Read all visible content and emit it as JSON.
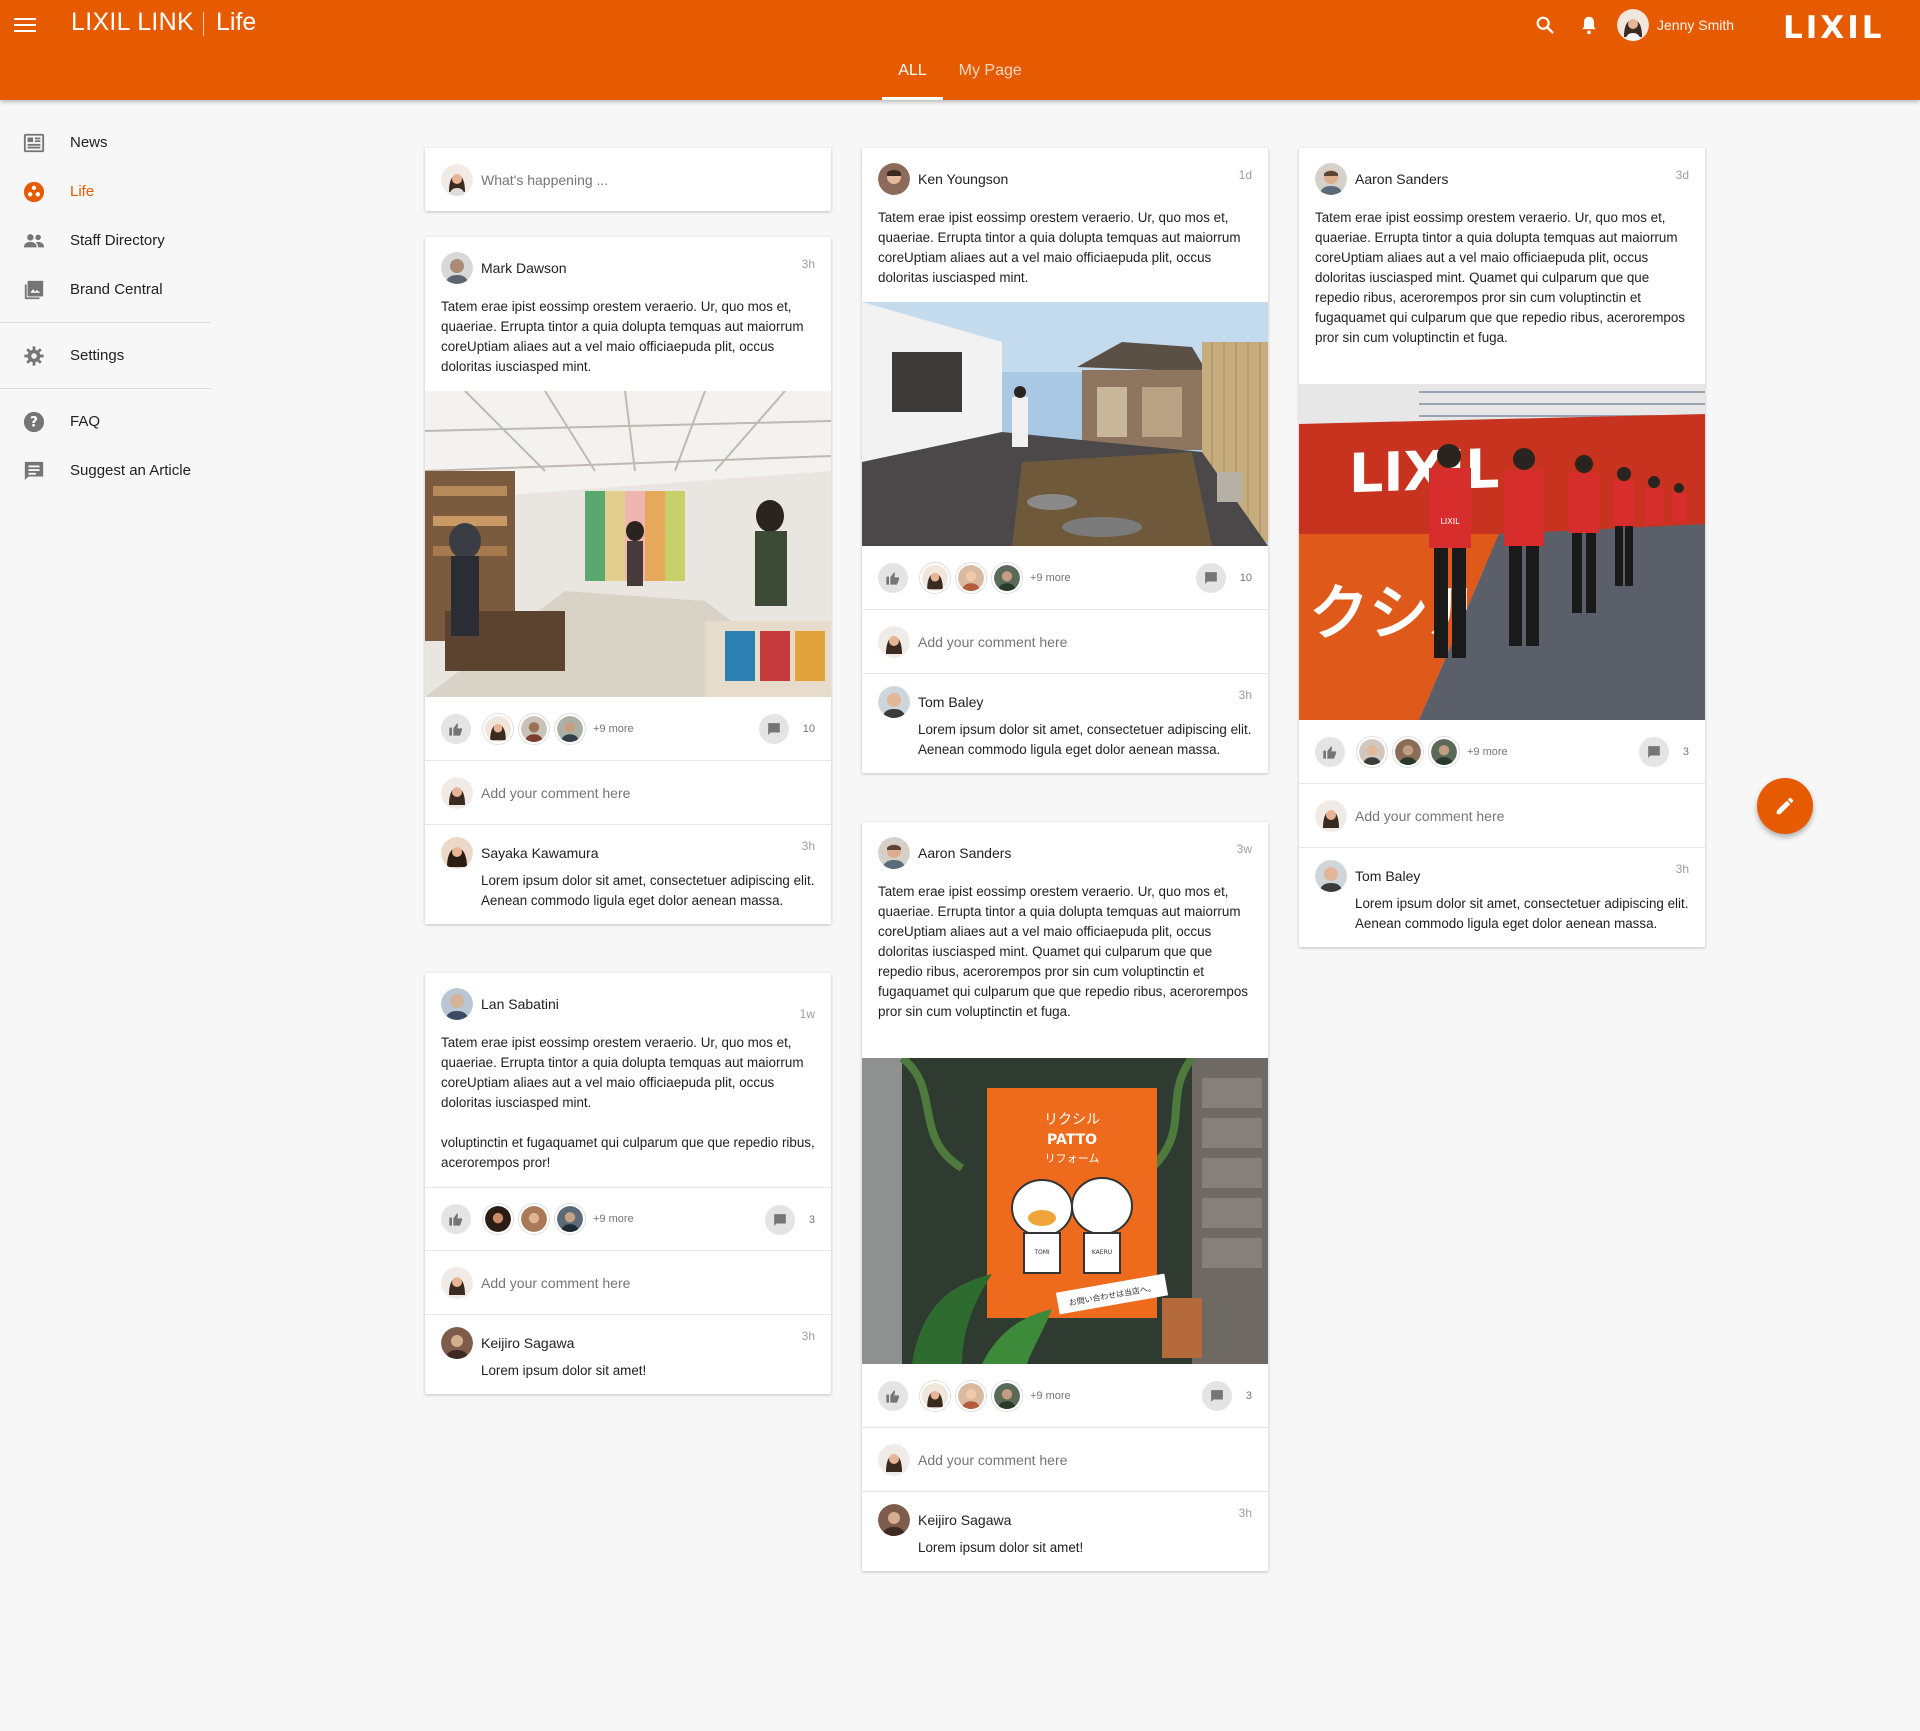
{
  "header": {
    "app_title": "LIXIL LINK",
    "section_title": "Life",
    "user_name": "Jenny Smith",
    "brand": "LIXIL",
    "tabs": [
      {
        "label": "ALL"
      },
      {
        "label": "My Page"
      }
    ]
  },
  "colors": {
    "accent": "#e65a00"
  },
  "sidebar": {
    "items": [
      {
        "label": "News",
        "icon": "newspaper-icon"
      },
      {
        "label": "Life",
        "icon": "life-icon"
      },
      {
        "label": "Staff Directory",
        "icon": "people-icon"
      },
      {
        "label": "Brand Central",
        "icon": "photo-library-icon"
      },
      {
        "label": "Settings",
        "icon": "gear-icon"
      },
      {
        "label": "FAQ",
        "icon": "help-icon"
      },
      {
        "label": "Suggest an Article",
        "icon": "feedback-icon"
      }
    ]
  },
  "composer": {
    "placeholder": "What's happening ..."
  },
  "comment_placeholder": "Add your comment here",
  "posts": [
    {
      "author": "Mark Dawson",
      "time": "3h",
      "body": [
        "Tatem erae ipist eossimp orestem veraerio. Ur, quo mos et, quaeriae. Errupta tintor a quia dolupta temquas aut maiorrum coreUptiam aliaes aut a vel maio officiaepuda plit, occus doloritas iusciasped mint."
      ],
      "more": "+9 more",
      "comments": "10",
      "comment": {
        "author": "Sayaka Kawamura",
        "time": "3h",
        "text": "Lorem ipsum dolor sit amet, consectetuer adipiscing elit. Aenean commodo ligula eget dolor aenean massa."
      }
    },
    {
      "author": "Lan Sabatini",
      "time": "1w",
      "body": [
        "Tatem erae ipist eossimp orestem veraerio. Ur, quo mos et, quaeriae. Errupta tintor a quia dolupta temquas aut maiorrum coreUptiam aliaes aut a vel maio officiaepuda plit, occus doloritas iusciasped mint.",
        "voluptinctin et fugaquamet qui culparum que que repedio ribus, acerorempos pror!"
      ],
      "more": "+9 more",
      "comments": "3",
      "comment": {
        "author": "Keijiro Sagawa",
        "time": "3h",
        "text": "Lorem ipsum dolor sit amet!"
      }
    },
    {
      "author": "Ken Youngson",
      "time": "1d",
      "body": [
        "Tatem erae ipist eossimp orestem veraerio. Ur, quo mos et, quaeriae. Errupta tintor a quia dolupta temquas aut maiorrum coreUptiam aliaes aut a vel maio officiaepuda plit, occus doloritas iusciasped mint."
      ],
      "more": "+9 more",
      "comments": "10",
      "comment": {
        "author": "Tom Baley",
        "time": "3h",
        "text": "Lorem ipsum dolor sit amet, consectetuer adipiscing elit. Aenean commodo ligula eget dolor aenean massa."
      }
    },
    {
      "author": "Aaron Sanders",
      "time": "3w",
      "body": [
        "Tatem erae ipist eossimp orestem veraerio. Ur, quo mos et, quaeriae. Errupta tintor a quia dolupta temquas aut maiorrum coreUptiam aliaes aut a vel maio officiaepuda plit, occus doloritas iusciasped mint. Quamet qui culparum que que repedio ribus, acerorempos pror sin cum voluptinctin et fugaquamet qui culparum que que repedio ribus, acerorempos pror sin cum voluptinctin et fuga."
      ],
      "more": "+9 more",
      "comments": "3",
      "comment": {
        "author": "Keijiro Sagawa",
        "time": "3h",
        "text": "Lorem ipsum dolor sit amet!"
      }
    },
    {
      "author": "Aaron Sanders",
      "time": "3d",
      "body": [
        "Tatem erae ipist eossimp orestem veraerio. Ur, quo mos et, quaeriae. Errupta tintor a quia dolupta temquas aut maiorrum coreUptiam aliaes aut a vel maio officiaepuda plit, occus doloritas iusciasped mint. Quamet qui culparum que que repedio ribus, acerorempos pror sin cum voluptinctin et fugaquamet qui culparum que que repedio ribus, acerorempos pror sin cum voluptinctin et fuga."
      ],
      "more": "+9 more",
      "comments": "3",
      "comment": {
        "author": "Tom Baley",
        "time": "3h",
        "text": "Lorem ipsum dolor sit amet, consectetuer adipiscing elit. Aenean commodo ligula eget dolor aenean massa."
      }
    }
  ],
  "image_text": {
    "stadium_banner": "LIXIL",
    "stadium_katakana": "クシル",
    "shirt_logo": "LIXIL",
    "poster_line1": "リクシル",
    "poster_line2": "PATTO",
    "poster_line3": "リフォーム",
    "poster_footer": "お問い合わせは当店へ。",
    "character_left": "TOMI",
    "character_right": "KAERU"
  }
}
